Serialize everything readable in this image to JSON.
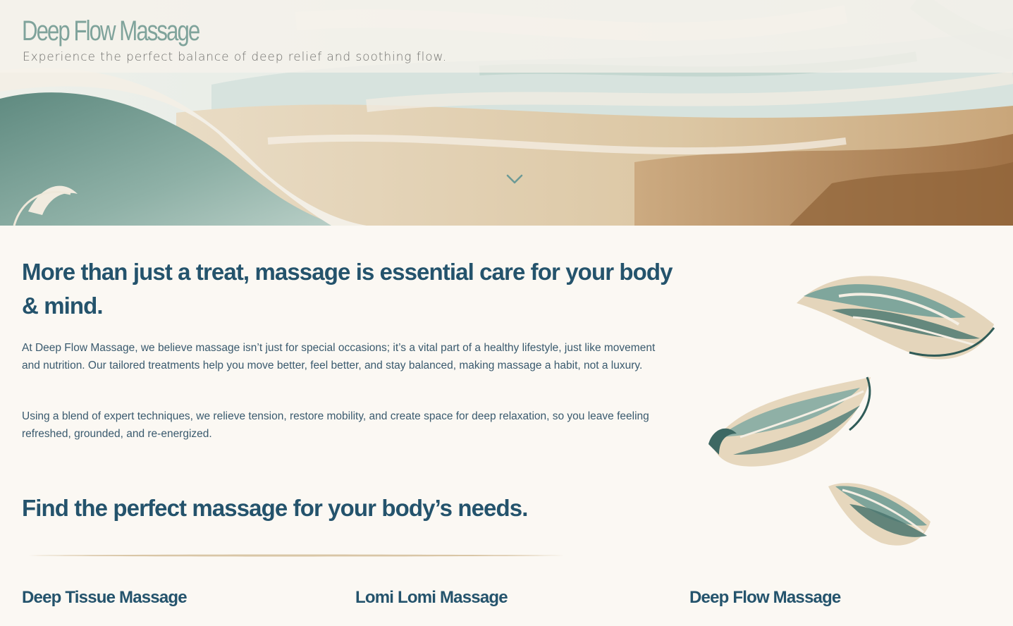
{
  "header": {
    "title": "Deep Flow Massage",
    "tagline": "Experience the perfect balance of deep relief and soothing flow."
  },
  "hero": {
    "scroll_icon": "chevron-down-icon",
    "colors": {
      "sage": "#8fb0a6",
      "teal": "#6f978f",
      "sand": "#e3d2b4",
      "brown": "#b48a5d",
      "cream": "#f4efe5"
    }
  },
  "intro": {
    "heading": "More than just a treat, massage is essential care for your body & mind.",
    "paragraph1": "At Deep Flow Massage, we believe massage isn’t just for special occasions; it’s a vital part of a healthy lifestyle, just like movement and nutrition. Our tailored treatments help you move better, feel better, and stay balanced, making massage a habit, not a luxury.",
    "paragraph2": "Using a blend of expert techniques, we relieve tension, restore mobility, and create space for deep relaxation, so you leave feeling refreshed, grounded, and re-energized."
  },
  "services": {
    "heading": "Find the perfect massage for your body’s needs.",
    "items": [
      {
        "title": "Deep Tissue Massage"
      },
      {
        "title": "Lomi Lomi Massage"
      },
      {
        "title": "Deep Flow Massage"
      }
    ]
  },
  "theme": {
    "heading_color": "#24536c",
    "title_color": "#7fa39b",
    "background": "#fbf8f3"
  }
}
